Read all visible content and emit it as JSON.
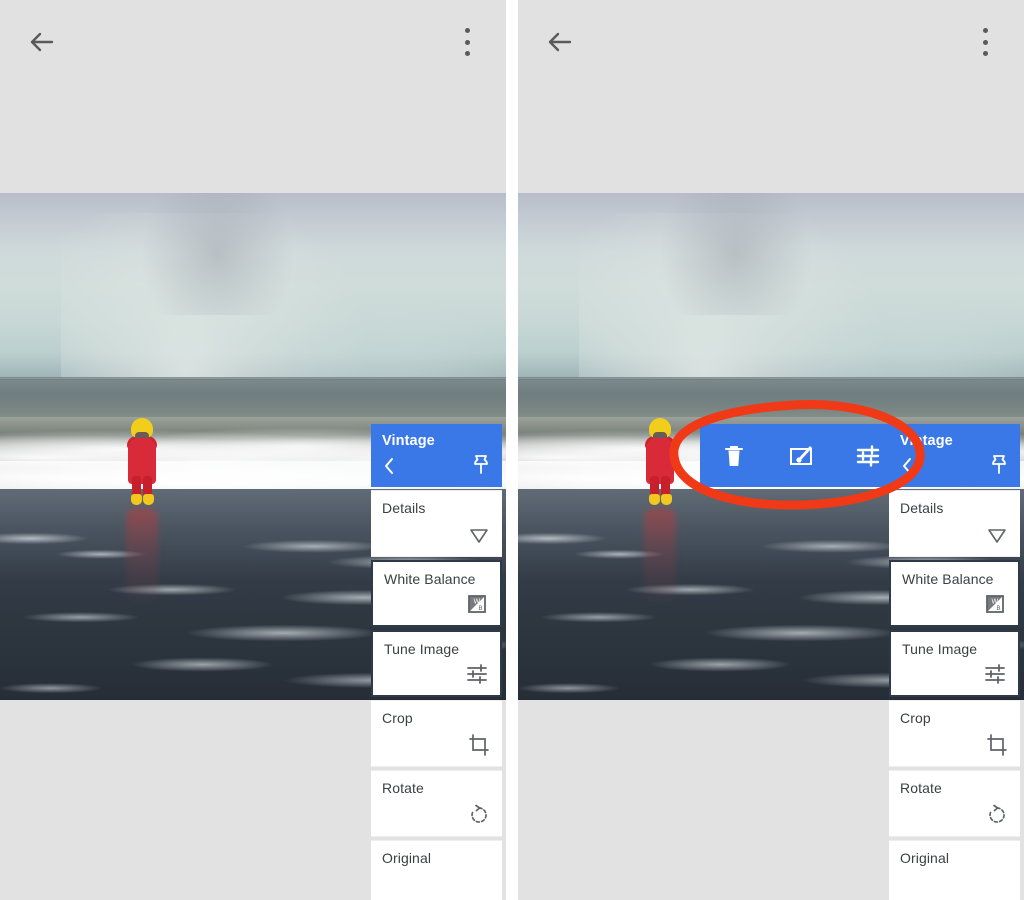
{
  "screenshot": {
    "kind": "side-by-side-mobile-screenshots",
    "app": "photo-editor",
    "panels": 2
  },
  "appbar": {
    "back_icon": "arrow-left-icon",
    "overflow_icon": "kebab-menu-icon",
    "background": "#e1e1e1"
  },
  "photo": {
    "description": "Child in red rain suit and yellow hat standing on a wet beach with ocean waves",
    "alt": "beach-photo"
  },
  "edit_stack": {
    "header": {
      "title": "Vintage",
      "back_icon": "chevron-left-icon",
      "pin_icon": "pin-icon",
      "accent": "#3b78e7",
      "text_color": "#ffffff"
    },
    "rows": [
      {
        "label": "Details",
        "icon": "details-triangle-icon",
        "selected": false
      },
      {
        "label": "White Balance",
        "icon": "white-balance-icon",
        "selected": true
      },
      {
        "label": "Tune Image",
        "icon": "tune-sliders-icon",
        "selected": true
      },
      {
        "label": "Crop",
        "icon": "crop-icon",
        "selected": false
      },
      {
        "label": "Rotate",
        "icon": "rotate-icon",
        "selected": false
      },
      {
        "label": "Original",
        "icon": "",
        "selected": false
      }
    ]
  },
  "blue_toolbar": {
    "visible_on_panel": "right",
    "background": "#3b78e7",
    "actions": [
      {
        "name": "delete",
        "icon": "trash-icon"
      },
      {
        "name": "edit",
        "icon": "edit-brush-icon"
      },
      {
        "name": "tune",
        "icon": "tune-sliders-icon"
      }
    ]
  },
  "annotation": {
    "shape": "ellipse",
    "color": "#f03a17",
    "target": "blue-toolbar",
    "panel": "right"
  },
  "watermark": {
    "icon": "camera-icon"
  }
}
